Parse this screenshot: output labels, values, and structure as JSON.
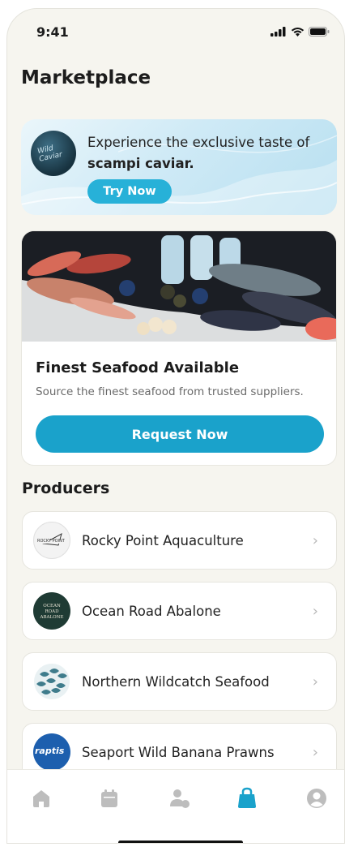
{
  "status_bar": {
    "time": "9:41"
  },
  "page": {
    "title": "Marketplace"
  },
  "promo": {
    "text_prefix": "Experience the exclusive taste of",
    "text_bold": "scampi caviar.",
    "button_label": "Try Now",
    "thumb_label": "Wild Caviar"
  },
  "feature": {
    "title": "Finest Seafood Available",
    "subtitle": "Source the finest seafood from trusted suppliers.",
    "button_label": "Request Now"
  },
  "producers": {
    "heading": "Producers",
    "items": [
      {
        "name": "Rocky Point Aquaculture",
        "logo_text": "ROCKY POINT"
      },
      {
        "name": "Ocean Road Abalone",
        "logo_text": "OCEAN ROAD ABALONE"
      },
      {
        "name": "Northern Wildcatch Seafood",
        "logo_text": ""
      },
      {
        "name": "Seaport Wild Banana Prawns",
        "logo_text": "raptis"
      }
    ]
  },
  "tabbar": {
    "items": [
      {
        "icon": "home-icon",
        "active": false
      },
      {
        "icon": "calendar-icon",
        "active": false
      },
      {
        "icon": "user-add-icon",
        "active": false
      },
      {
        "icon": "shopping-bag-icon",
        "active": true
      },
      {
        "icon": "profile-icon",
        "active": false
      }
    ],
    "active_color": "#1aa2cb",
    "inactive_color": "#bdbdbd"
  },
  "colors": {
    "accent": "#1aa2cb",
    "background": "#f6f5ef"
  }
}
